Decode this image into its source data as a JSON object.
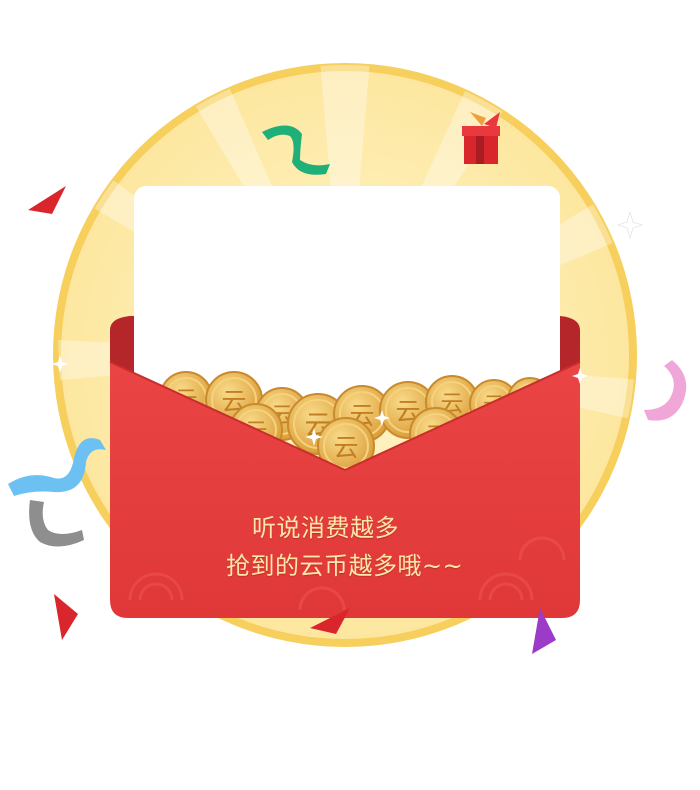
{
  "promo": {
    "line1": "听说消费越多",
    "line2": "抢到的云币越多哦~~"
  },
  "coins": {
    "glyph": "云"
  },
  "colors": {
    "envelope_red": "#e63c3c",
    "envelope_dark": "#b5262b",
    "sun_yellow": "#fde9a3",
    "sun_ring": "#f7d36b",
    "coin_gold": "#e8b24a",
    "text_gold": "#ffe7a8"
  },
  "icons": {
    "gift": "gift-box-icon",
    "sparkle": "sparkle-icon"
  }
}
